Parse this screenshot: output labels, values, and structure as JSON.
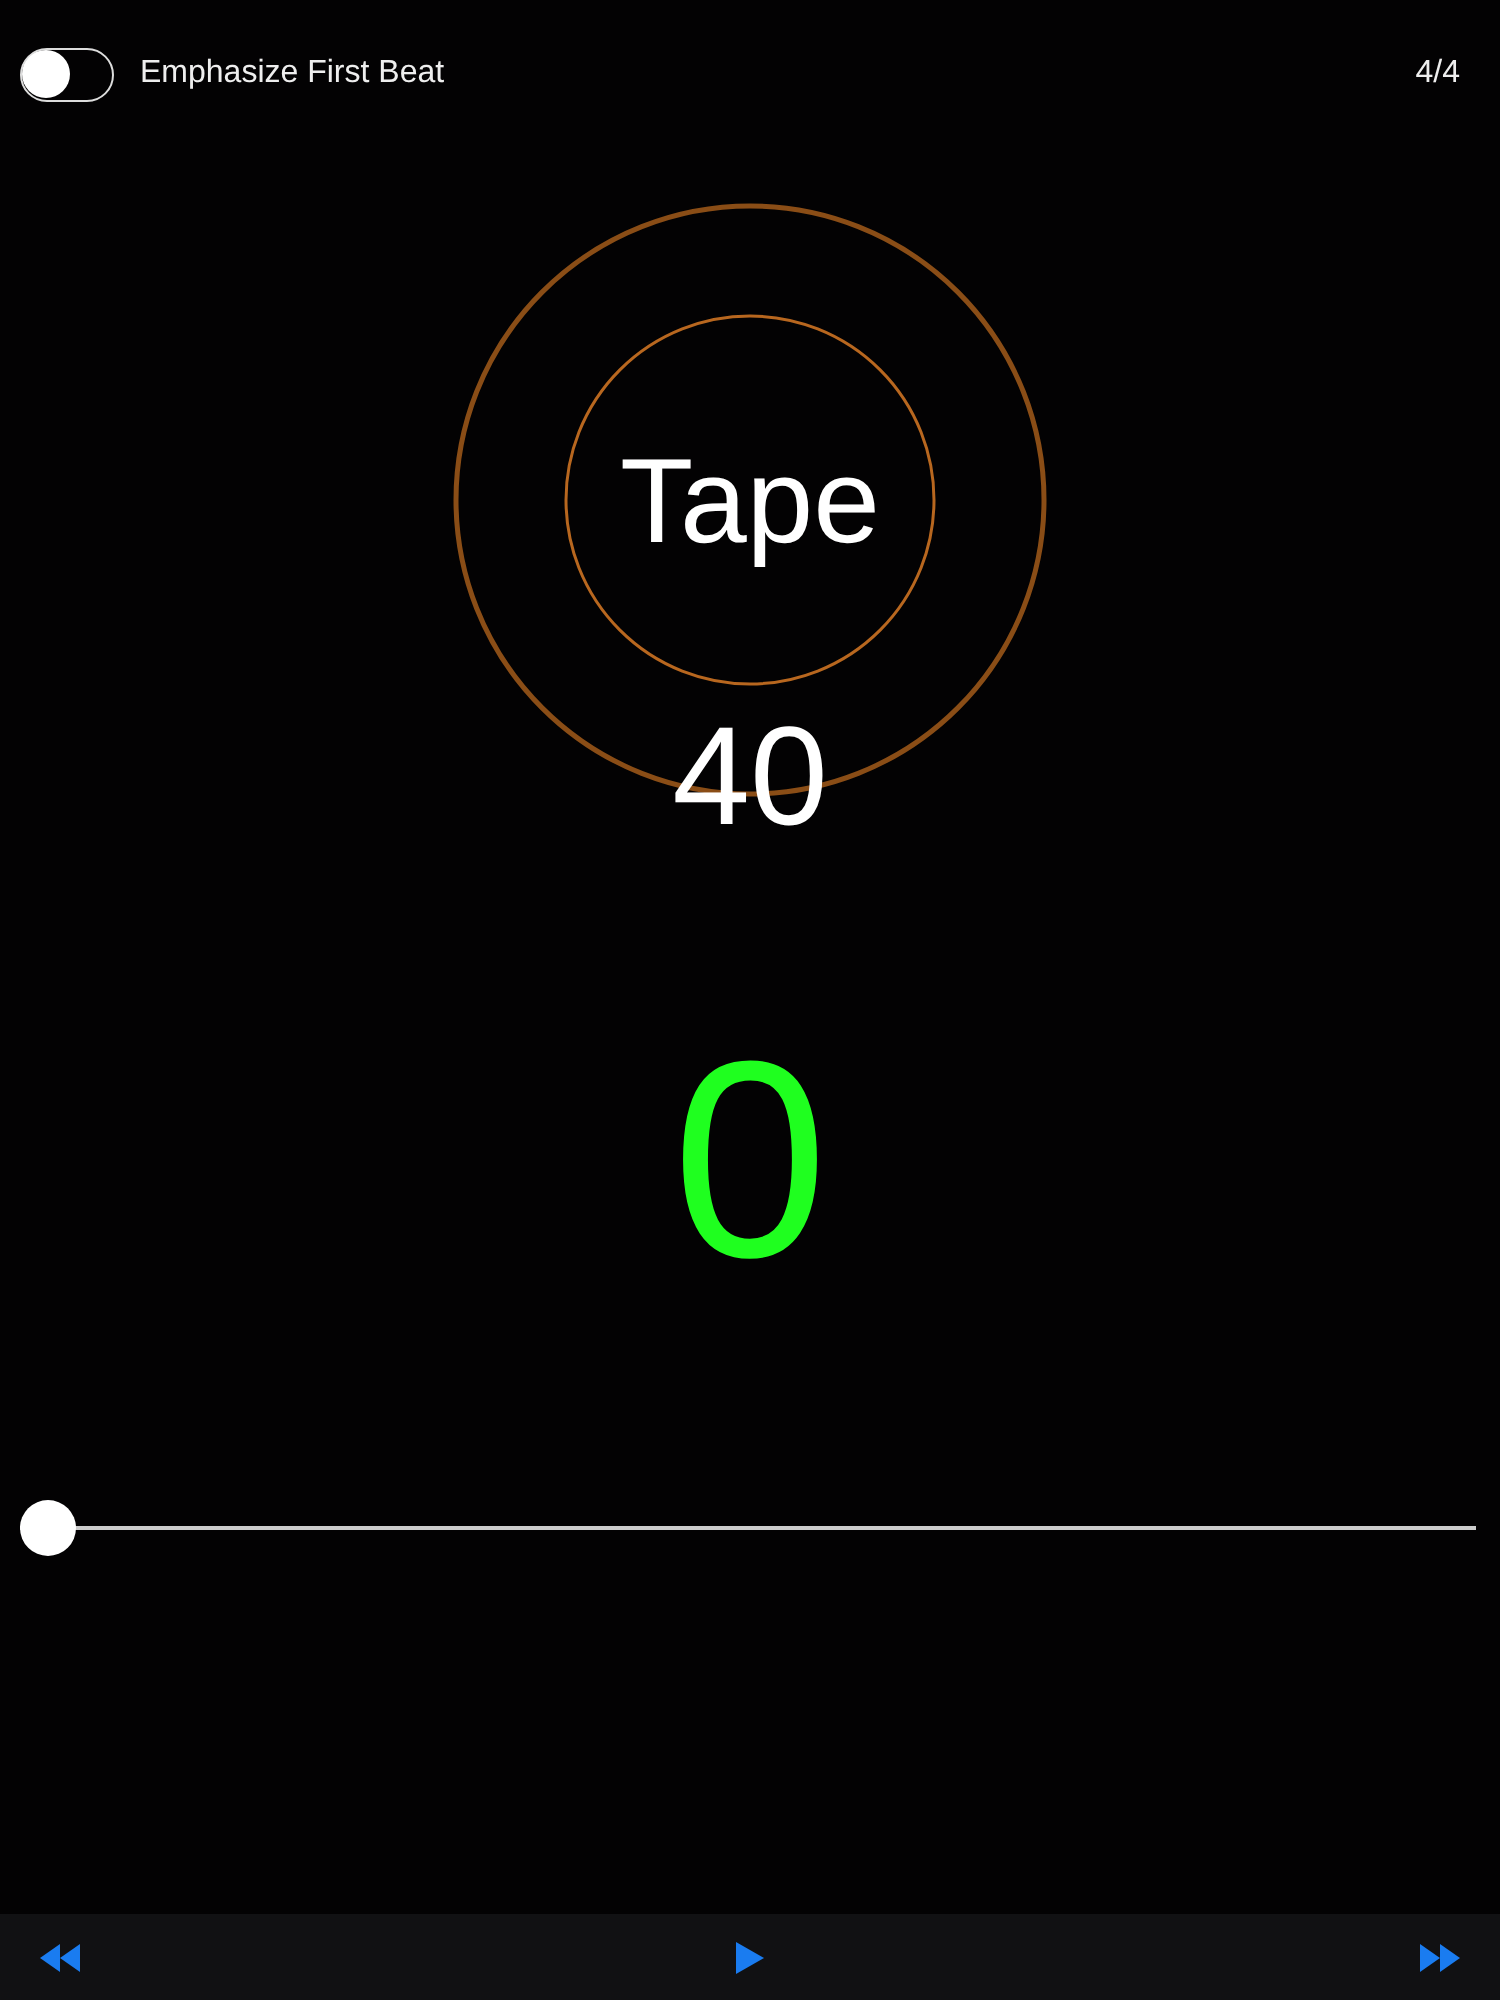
{
  "header": {
    "toggle": {
      "label": "Emphasize First Beat",
      "on": false
    },
    "time_signature": "4/4"
  },
  "dial": {
    "label": "Tape"
  },
  "tempo": "40",
  "count": "0",
  "slider": {
    "level": 0
  },
  "toolbar": [
    {
      "kind": "rewind"
    },
    {
      "kind": "play"
    },
    {
      "kind": "fast-forward"
    }
  ]
}
